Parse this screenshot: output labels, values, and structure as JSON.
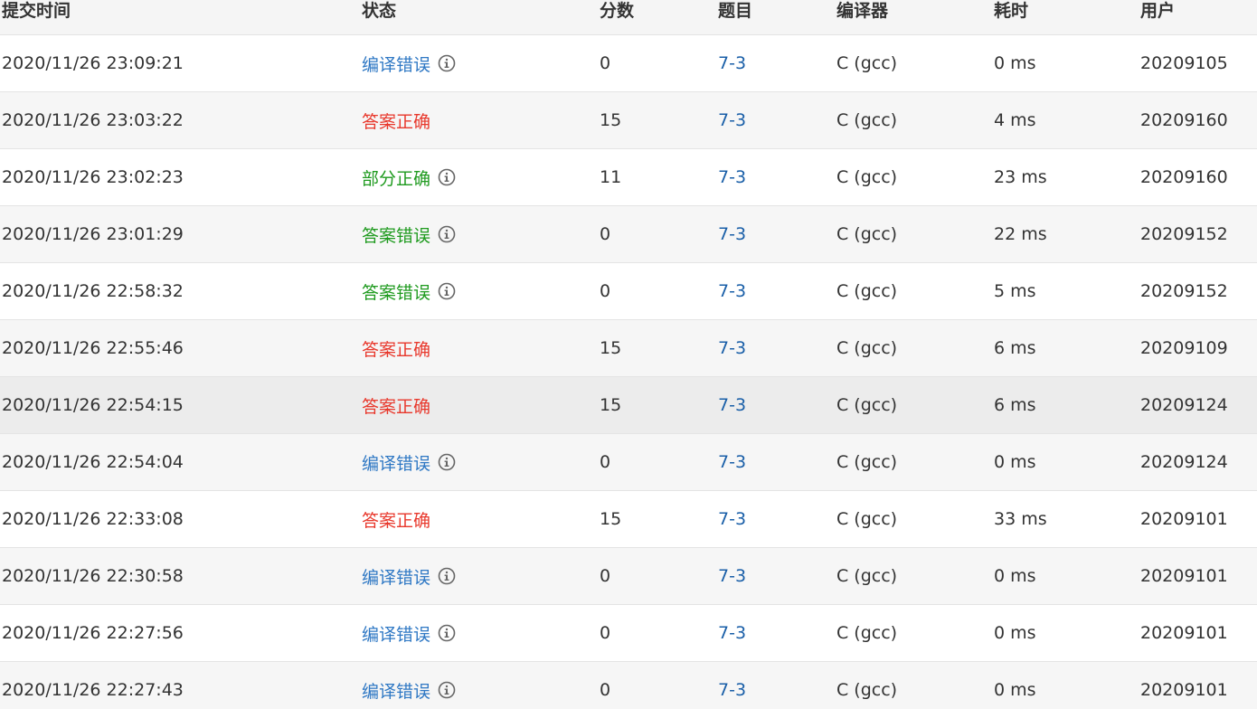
{
  "headers": {
    "time": "提交时间",
    "status": "状态",
    "score": "分数",
    "problem": "题目",
    "compiler": "编译器",
    "runtime": "耗时",
    "user": "用户"
  },
  "colors": {
    "compile_error": "#2f78c4",
    "accepted": "#e8372b",
    "partial": "#1e9a1e",
    "wrong_answer": "#1e9a1e",
    "icon": "#666666"
  },
  "rows": [
    {
      "time": "2020/11/26 23:09:21",
      "status": "编译错误",
      "status_type": "compile_error",
      "info_icon": true,
      "score": "0",
      "problem": "7-3",
      "compiler": "C (gcc)",
      "runtime": "0 ms",
      "user": "20209105"
    },
    {
      "time": "2020/11/26 23:03:22",
      "status": "答案正确",
      "status_type": "accepted",
      "info_icon": false,
      "score": "15",
      "problem": "7-3",
      "compiler": "C (gcc)",
      "runtime": "4 ms",
      "user": "20209160"
    },
    {
      "time": "2020/11/26 23:02:23",
      "status": "部分正确",
      "status_type": "partial",
      "info_icon": true,
      "score": "11",
      "problem": "7-3",
      "compiler": "C (gcc)",
      "runtime": "23 ms",
      "user": "20209160"
    },
    {
      "time": "2020/11/26 23:01:29",
      "status": "答案错误",
      "status_type": "wrong_answer",
      "info_icon": true,
      "score": "0",
      "problem": "7-3",
      "compiler": "C (gcc)",
      "runtime": "22 ms",
      "user": "20209152"
    },
    {
      "time": "2020/11/26 22:58:32",
      "status": "答案错误",
      "status_type": "wrong_answer",
      "info_icon": true,
      "score": "0",
      "problem": "7-3",
      "compiler": "C (gcc)",
      "runtime": "5 ms",
      "user": "20209152"
    },
    {
      "time": "2020/11/26 22:55:46",
      "status": "答案正确",
      "status_type": "accepted",
      "info_icon": false,
      "score": "15",
      "problem": "7-3",
      "compiler": "C (gcc)",
      "runtime": "6 ms",
      "user": "20209109"
    },
    {
      "time": "2020/11/26 22:54:15",
      "status": "答案正确",
      "status_type": "accepted",
      "info_icon": false,
      "score": "15",
      "problem": "7-3",
      "compiler": "C (gcc)",
      "runtime": "6 ms",
      "user": "20209124"
    },
    {
      "time": "2020/11/26 22:54:04",
      "status": "编译错误",
      "status_type": "compile_error",
      "info_icon": true,
      "score": "0",
      "problem": "7-3",
      "compiler": "C (gcc)",
      "runtime": "0 ms",
      "user": "20209124"
    },
    {
      "time": "2020/11/26 22:33:08",
      "status": "答案正确",
      "status_type": "accepted",
      "info_icon": false,
      "score": "15",
      "problem": "7-3",
      "compiler": "C (gcc)",
      "runtime": "33 ms",
      "user": "20209101"
    },
    {
      "time": "2020/11/26 22:30:58",
      "status": "编译错误",
      "status_type": "compile_error",
      "info_icon": true,
      "score": "0",
      "problem": "7-3",
      "compiler": "C (gcc)",
      "runtime": "0 ms",
      "user": "20209101"
    },
    {
      "time": "2020/11/26 22:27:56",
      "status": "编译错误",
      "status_type": "compile_error",
      "info_icon": true,
      "score": "0",
      "problem": "7-3",
      "compiler": "C (gcc)",
      "runtime": "0 ms",
      "user": "20209101"
    },
    {
      "time": "2020/11/26 22:27:43",
      "status": "编译错误",
      "status_type": "compile_error",
      "info_icon": true,
      "score": "0",
      "problem": "7-3",
      "compiler": "C (gcc)",
      "runtime": "0 ms",
      "user": "20209101"
    }
  ]
}
